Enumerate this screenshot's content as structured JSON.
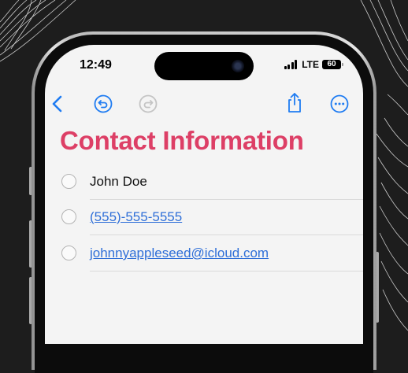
{
  "status_bar": {
    "time": "12:49",
    "network": "LTE",
    "battery": "60"
  },
  "toolbar": {
    "icons": [
      "back-chevron-icon",
      "undo-icon",
      "redo-icon",
      "share-icon",
      "more-icon"
    ]
  },
  "note": {
    "title": "Contact Information",
    "items": [
      {
        "text": "John Doe",
        "is_link": false
      },
      {
        "text": "(555)-555-5555",
        "is_link": true
      },
      {
        "text": "johnnyappleseed@icloud.com",
        "is_link": true
      }
    ]
  },
  "colors": {
    "title": "#dd3f66",
    "accent": "#2f6fd8",
    "background": "#1d1d1d"
  }
}
